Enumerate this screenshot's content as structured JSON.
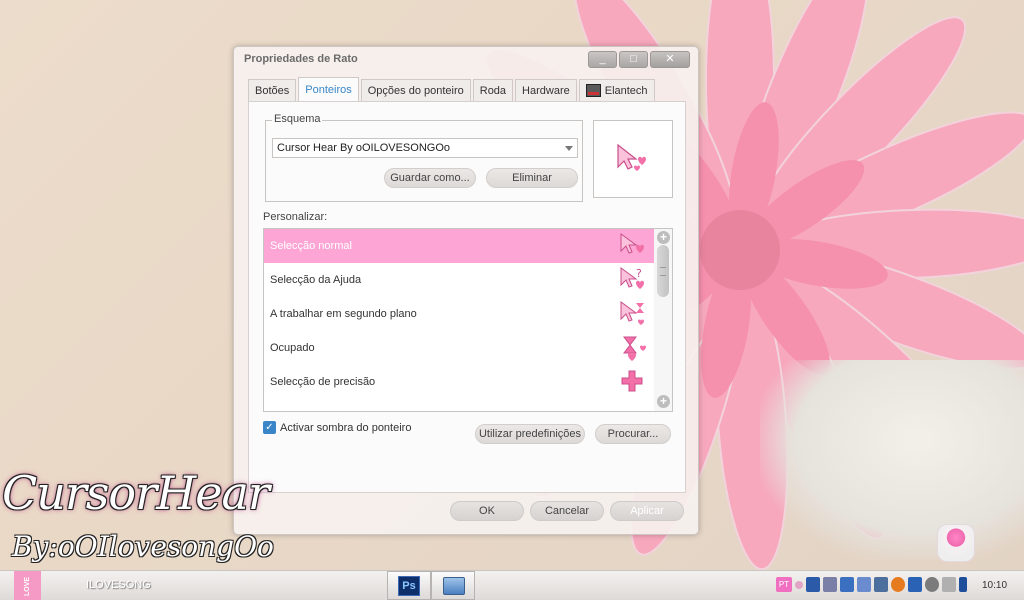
{
  "window": {
    "title": "Propriedades de Rato",
    "controls": [
      "_",
      "□",
      "✕"
    ]
  },
  "tabs": [
    {
      "label": "Botões",
      "active": false
    },
    {
      "label": "Ponteiros",
      "active": true
    },
    {
      "label": "Opções do ponteiro",
      "active": false
    },
    {
      "label": "Roda",
      "active": false
    },
    {
      "label": "Hardware",
      "active": false
    },
    {
      "label": "Elantech",
      "active": false
    }
  ],
  "scheme": {
    "legend": "Esquema",
    "selected": "Cursor Hear By oOILOVESONGOo",
    "save_label": "Guardar como...",
    "delete_label": "Eliminar"
  },
  "customize": {
    "label": "Personalizar:",
    "items": [
      {
        "label": "Selecção normal",
        "selected": true
      },
      {
        "label": "Selecção da Ajuda",
        "selected": false
      },
      {
        "label": "A trabalhar em segundo plano",
        "selected": false
      },
      {
        "label": "Ocupado",
        "selected": false
      },
      {
        "label": "Selecção de precisão",
        "selected": false
      }
    ]
  },
  "options": {
    "shadow_label": "Activar sombra do ponteiro",
    "shadow_checked": true,
    "defaults_label": "Utilizar predefinições",
    "browse_label": "Procurar..."
  },
  "dialog_buttons": {
    "ok": "OK",
    "cancel": "Cancelar",
    "apply": "Aplicar"
  },
  "desktop": {
    "signature_line1": "CursorHear",
    "signature_line2": "By:oOIlovesongOo"
  },
  "taskbar": {
    "start_text": "LOVE",
    "label": "ILOVESONG",
    "ps_text": "Ps",
    "tray_pt": "PT",
    "clock": "10:10"
  },
  "colors": {
    "accent_pink": "#fda6d5",
    "tab_active_text": "#3a86c8",
    "checkbox_blue": "#3a86c8"
  }
}
